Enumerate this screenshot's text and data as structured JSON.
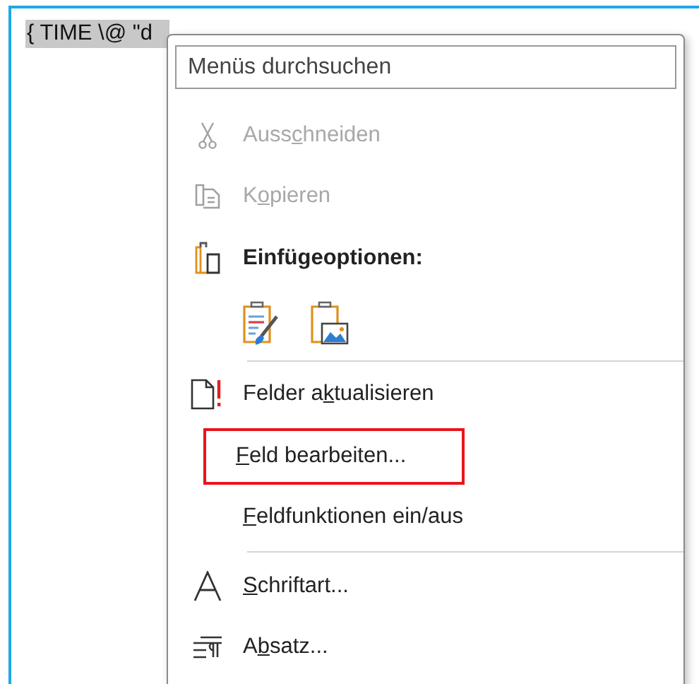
{
  "document": {
    "field_code": "{ TIME \\@ \"d"
  },
  "context_menu": {
    "search": {
      "placeholder": "Menüs durchsuchen"
    },
    "items": [
      {
        "kind": "command",
        "pre": "Auss",
        "key": "c",
        "post": "hneiden",
        "disabled": true,
        "highlighted": false
      },
      {
        "kind": "command",
        "pre": "K",
        "key": "o",
        "post": "pieren",
        "disabled": true,
        "highlighted": false
      },
      {
        "kind": "heading",
        "label": "Einfügeoptionen:"
      },
      {
        "kind": "paste-options"
      },
      {
        "kind": "separator"
      },
      {
        "kind": "command",
        "pre": "Felder a",
        "key": "k",
        "post": "tualisieren",
        "disabled": false,
        "highlighted": false
      },
      {
        "kind": "command",
        "key": "F",
        "post": "eld bearbeiten...",
        "disabled": false,
        "highlighted": true
      },
      {
        "kind": "command",
        "key": "F",
        "post": "eldfunktionen ein/aus",
        "disabled": false,
        "highlighted": false
      },
      {
        "kind": "separator"
      },
      {
        "kind": "command",
        "key": "S",
        "post": "chriftart...",
        "disabled": false,
        "highlighted": false
      },
      {
        "kind": "command",
        "pre": "A",
        "key": "b",
        "post": "satz...",
        "disabled": false,
        "highlighted": false
      }
    ]
  }
}
